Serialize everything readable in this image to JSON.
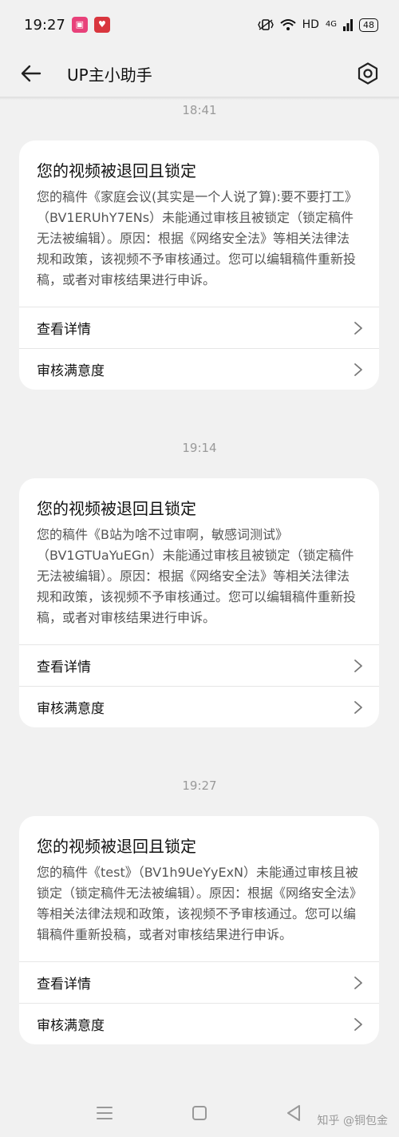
{
  "status_bar": {
    "time": "19:27",
    "network": "HD",
    "signal": "4G",
    "battery": "48"
  },
  "app_bar": {
    "title": "UP主小助手"
  },
  "messages": [
    {
      "time": "18:41",
      "title": "您的视频被退回且锁定",
      "body": "您的稿件《家庭会议(其实是一个人说了算):要不要打工》（BV1ERUhY7ENs）未能通过审核且被锁定（锁定稿件无法被编辑）。原因：根据《网络安全法》等相关法律法规和政策，该视频不予审核通过。您可以编辑稿件重新投稿，或者对审核结果进行申诉。",
      "actions": [
        "查看详情",
        "审核满意度"
      ]
    },
    {
      "time": "19:14",
      "title": "您的视频被退回且锁定",
      "body": "您的稿件《B站为啥不过审啊，敏感词测试》（BV1GTUaYuEGn）未能通过审核且被锁定（锁定稿件无法被编辑）。原因：根据《网络安全法》等相关法律法规和政策，该视频不予审核通过。您可以编辑稿件重新投稿，或者对审核结果进行申诉。",
      "actions": [
        "查看详情",
        "审核满意度"
      ]
    },
    {
      "time": "19:27",
      "title": "您的视频被退回且锁定",
      "body": "您的稿件《test》（BV1h9UeYyExN）未能通过审核且被锁定（锁定稿件无法被编辑）。原因：根据《网络安全法》等相关法律法规和政策，该视频不予审核通过。您可以编辑稿件重新投稿，或者对审核结果进行申诉。",
      "actions": [
        "查看详情",
        "审核满意度"
      ]
    }
  ],
  "watermark": "知乎 @铜包金",
  "colors": {
    "background": "#f1f1f1",
    "card": "#ffffff",
    "secondary_text": "#9a9a9a"
  }
}
